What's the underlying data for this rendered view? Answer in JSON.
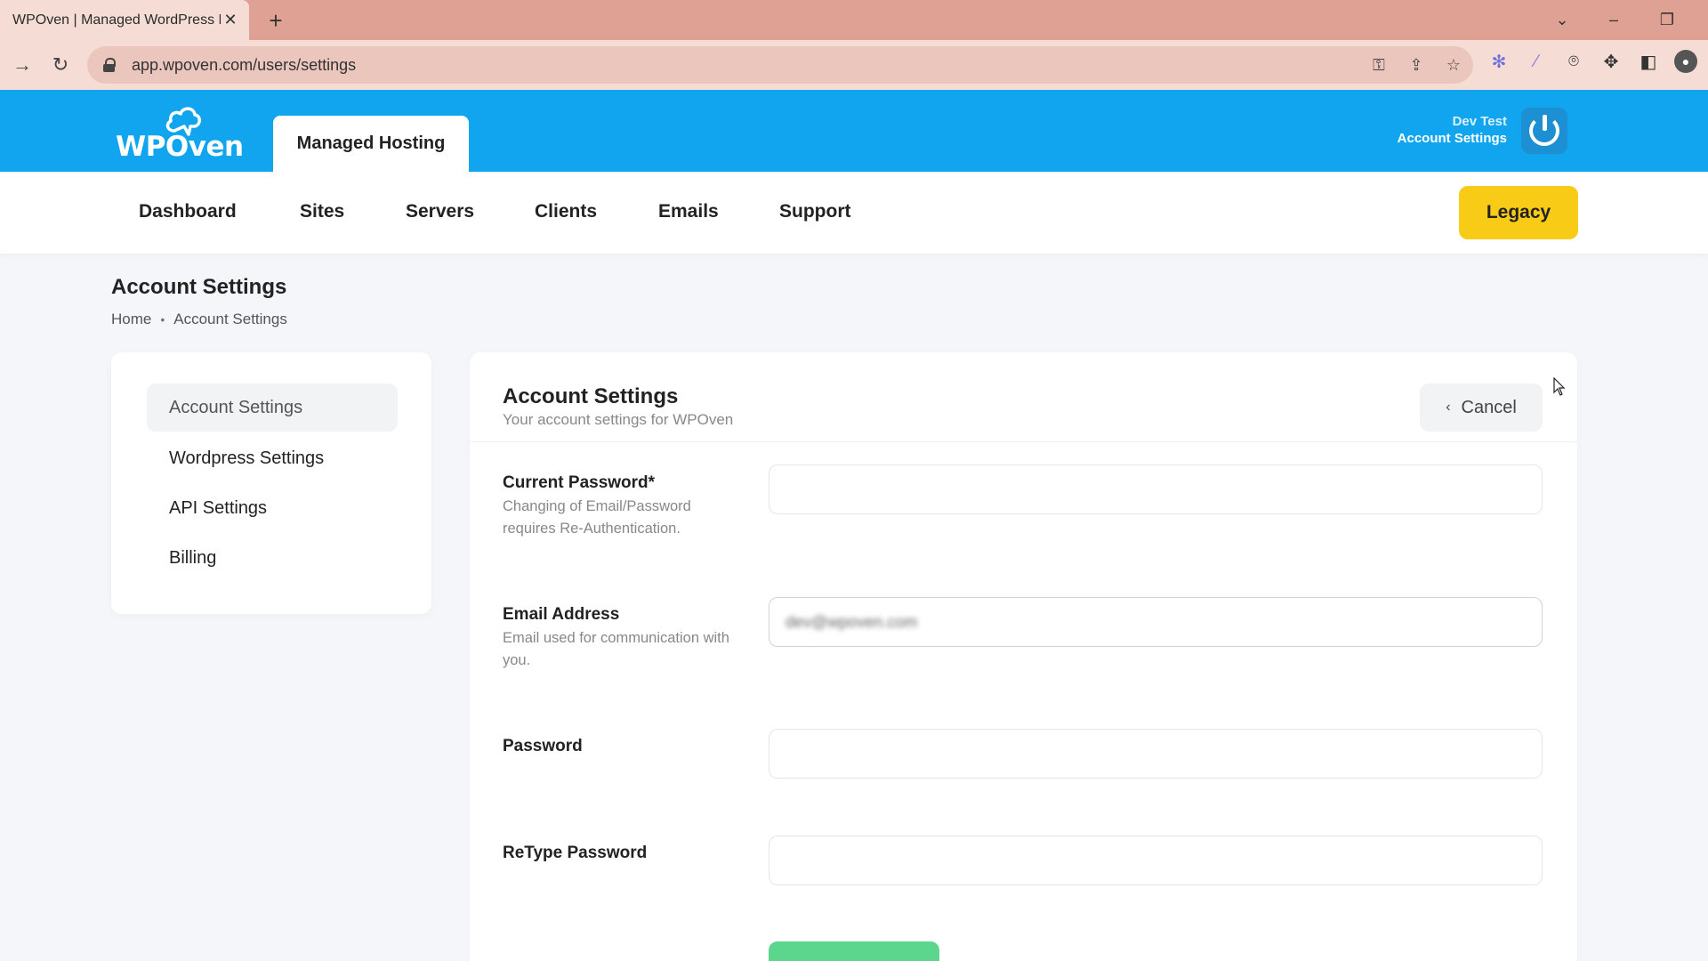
{
  "browser": {
    "tab_title": "WPOven | Managed WordPress H",
    "tab_close": "✕",
    "new_tab": "+",
    "url": "app.wpoven.com/users/settings"
  },
  "header": {
    "logo_text": "WPOven",
    "active_tab": "Managed Hosting",
    "user_name": "Dev Test",
    "user_link": "Account Settings",
    "brand_color": "#10a5ee"
  },
  "nav": {
    "items": [
      "Dashboard",
      "Sites",
      "Servers",
      "Clients",
      "Emails",
      "Support"
    ],
    "legacy_label": "Legacy",
    "legacy_color": "#f8cb17"
  },
  "page": {
    "title": "Account Settings",
    "breadcrumb": {
      "home": "Home",
      "sep": "•",
      "current": "Account Settings"
    }
  },
  "sidebar": {
    "items": [
      {
        "label": "Account Settings",
        "active": true
      },
      {
        "label": "Wordpress Settings",
        "active": false
      },
      {
        "label": "API Settings",
        "active": false
      },
      {
        "label": "Billing",
        "active": false
      }
    ]
  },
  "card": {
    "title": "Account Settings",
    "subtitle": "Your account settings for WPOven",
    "cancel_label": "Cancel",
    "fields": [
      {
        "label": "Current Password*",
        "help": "Changing of Email/Password requires Re-Authentication.",
        "value": ""
      },
      {
        "label": "Email Address",
        "help": "Email used for communication with you.",
        "value": "dev@wpoven.com"
      },
      {
        "label": "Password",
        "help": "",
        "value": ""
      },
      {
        "label": "ReType Password",
        "help": "",
        "value": ""
      }
    ],
    "submit_color": "#5cd68d"
  }
}
